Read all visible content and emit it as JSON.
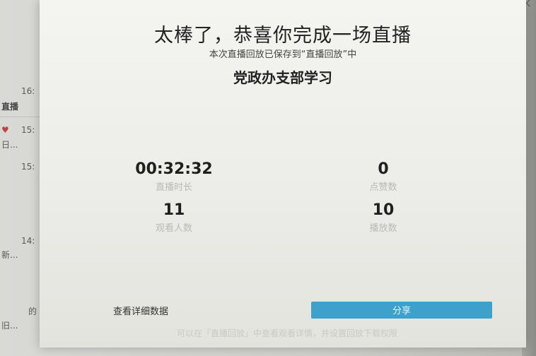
{
  "background": {
    "times": [
      "16:",
      "15:",
      "15:",
      "14:"
    ],
    "item_label_live": "直播",
    "item_text_1": "日...",
    "item_text_2": "新...",
    "item_text_3": "的",
    "item_text_4": "旧..."
  },
  "dialog": {
    "title": "太棒了，恭喜你完成一场直播",
    "subtitle": "本次直播回放已保存到“直播回放”中",
    "live_name": "党政办支部学习",
    "stats": [
      {
        "value": "00:32:32",
        "label": "直播时长"
      },
      {
        "value": "0",
        "label": "点赞数"
      },
      {
        "value": "11",
        "label": "观看人数"
      },
      {
        "value": "10",
        "label": "播放数"
      }
    ],
    "detail_link": "查看详细数据",
    "share_label": "分享",
    "footer_note": "可以在「直播回放」中查看观看详情，并设置回放下载权限"
  },
  "colors": {
    "accent": "#3ea1cc",
    "label_gray": "#b9b9b6"
  }
}
